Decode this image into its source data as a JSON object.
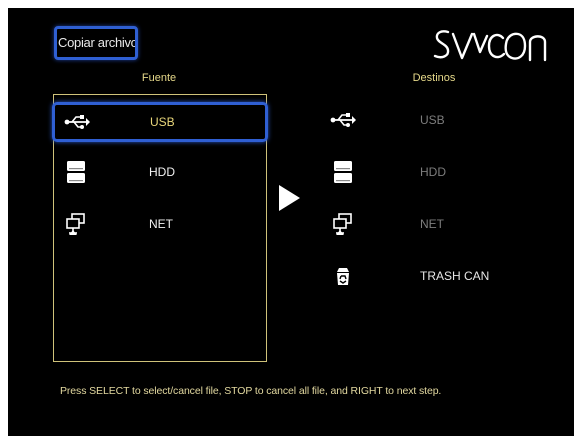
{
  "window": {
    "title": "Copiar archivo"
  },
  "brand": {
    "logo_text": "SVEON"
  },
  "source": {
    "header": "Fuente",
    "items": [
      {
        "label": "USB",
        "icon": "usb-icon",
        "selected": true
      },
      {
        "label": "HDD",
        "icon": "hdd-icon",
        "selected": false
      },
      {
        "label": "NET",
        "icon": "network-icon",
        "selected": false
      }
    ]
  },
  "destination": {
    "header": "Destinos",
    "items": [
      {
        "label": "USB",
        "icon": "usb-icon",
        "enabled": false
      },
      {
        "label": "HDD",
        "icon": "hdd-icon",
        "enabled": false
      },
      {
        "label": "NET",
        "icon": "network-icon",
        "enabled": false
      },
      {
        "label": "TRASH CAN",
        "icon": "recycle-icon",
        "enabled": true
      }
    ]
  },
  "hint": {
    "text": "Press SELECT to select/cancel file, STOP to cancel all file, and RIGHT to next step."
  },
  "colors": {
    "background": "#000000",
    "selection_border": "#2f5fd3",
    "panel_border": "#cfc27a",
    "header_text": "#e6d98a",
    "selected_text": "#e8d67a",
    "disabled_text": "#7d7d7d"
  }
}
